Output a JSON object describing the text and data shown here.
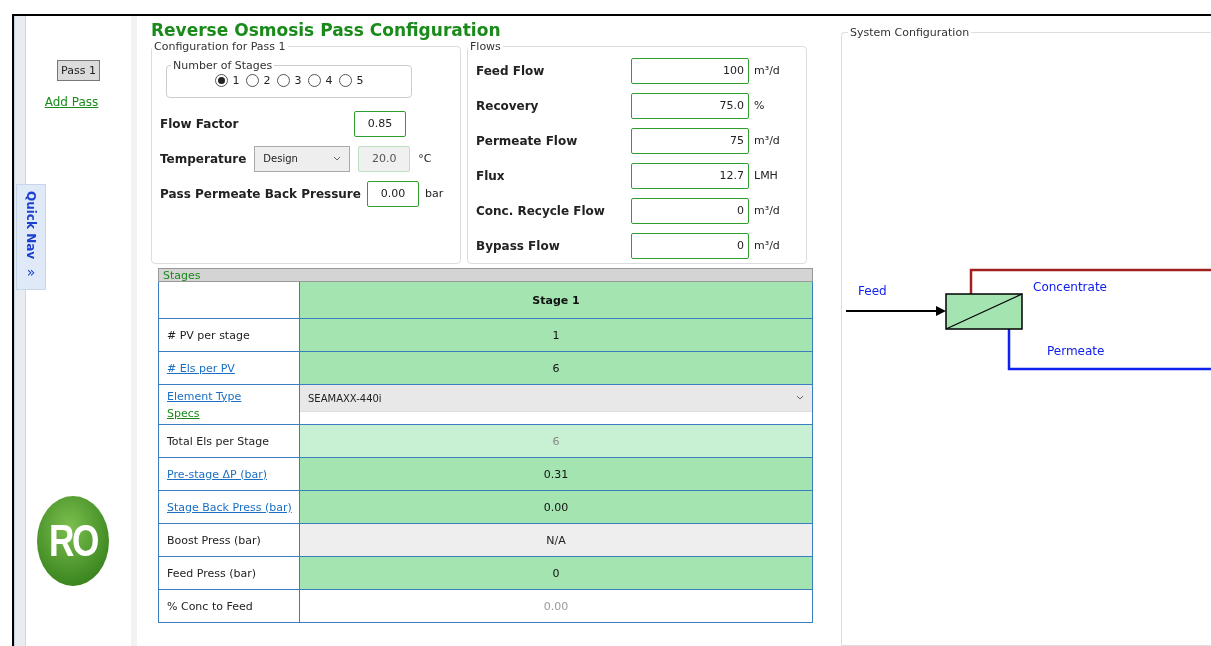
{
  "sidebar": {
    "passes": [
      {
        "label": "Pass 1",
        "selected": true
      }
    ],
    "add_pass": "Add Pass",
    "quick_nav": {
      "label": "Quick Nav",
      "icon": "»"
    },
    "logo": {
      "text": "RO"
    }
  },
  "title": "Reverse Osmosis Pass Configuration",
  "configuration": {
    "legend": "Configuration for Pass 1",
    "stages": {
      "legend": "Number of Stages",
      "options": [
        {
          "label": "1",
          "selected": true
        },
        {
          "label": "2",
          "selected": false
        },
        {
          "label": "3",
          "selected": false
        },
        {
          "label": "4",
          "selected": false
        },
        {
          "label": "5",
          "selected": false
        }
      ]
    },
    "flow_factor": {
      "label": "Flow Factor",
      "value": "0.85"
    },
    "temperature": {
      "label": "Temperature",
      "mode": "Design",
      "value": "20.0",
      "unit": "°C",
      "disabled": true
    },
    "back_pressure": {
      "label": "Pass Permeate Back Pressure",
      "value": "0.00",
      "unit": "bar"
    }
  },
  "flows": {
    "legend": "Flows",
    "rows": [
      {
        "label": "Feed Flow",
        "value": "100",
        "unit": "m³/d"
      },
      {
        "label": "Recovery",
        "value": "75.0",
        "unit": "%"
      },
      {
        "label": "Permeate Flow",
        "value": "75",
        "unit": "m³/d"
      },
      {
        "label": "Flux",
        "value": "12.7",
        "unit": "LMH"
      },
      {
        "label": "Conc. Recycle Flow",
        "value": "0",
        "unit": "m³/d"
      },
      {
        "label": "Bypass Flow",
        "value": "0",
        "unit": "m³/d"
      }
    ]
  },
  "stages_table": {
    "title": "Stages",
    "columns": [
      "Stage 1"
    ],
    "rows": [
      {
        "label": "# PV per stage",
        "link": false,
        "kind": "input",
        "value": "1"
      },
      {
        "label": "# Els per PV",
        "link": true,
        "kind": "input",
        "value": "6"
      },
      {
        "label": "Element Type",
        "specs": "Specs",
        "link": true,
        "kind": "select",
        "value": "SEAMAXX-440i"
      },
      {
        "label": "Total Els per Stage",
        "link": false,
        "kind": "computed",
        "value": "6"
      },
      {
        "label": "Pre-stage ΔP (bar)",
        "link": true,
        "kind": "input",
        "value": "0.31"
      },
      {
        "label": "Stage Back Press (bar)",
        "link": true,
        "kind": "input",
        "value": "0.00"
      },
      {
        "label": "Boost Press (bar)",
        "link": false,
        "kind": "disabled",
        "value": "N/A"
      },
      {
        "label": "Feed Press (bar)",
        "link": false,
        "kind": "input",
        "value": "0"
      },
      {
        "label": "% Conc to Feed",
        "link": false,
        "kind": "output",
        "value": "0.00"
      }
    ]
  },
  "system": {
    "legend": "System Configuration",
    "labels": {
      "feed": "Feed",
      "concentrate": "Concentrate",
      "permeate": "Permeate"
    }
  }
}
